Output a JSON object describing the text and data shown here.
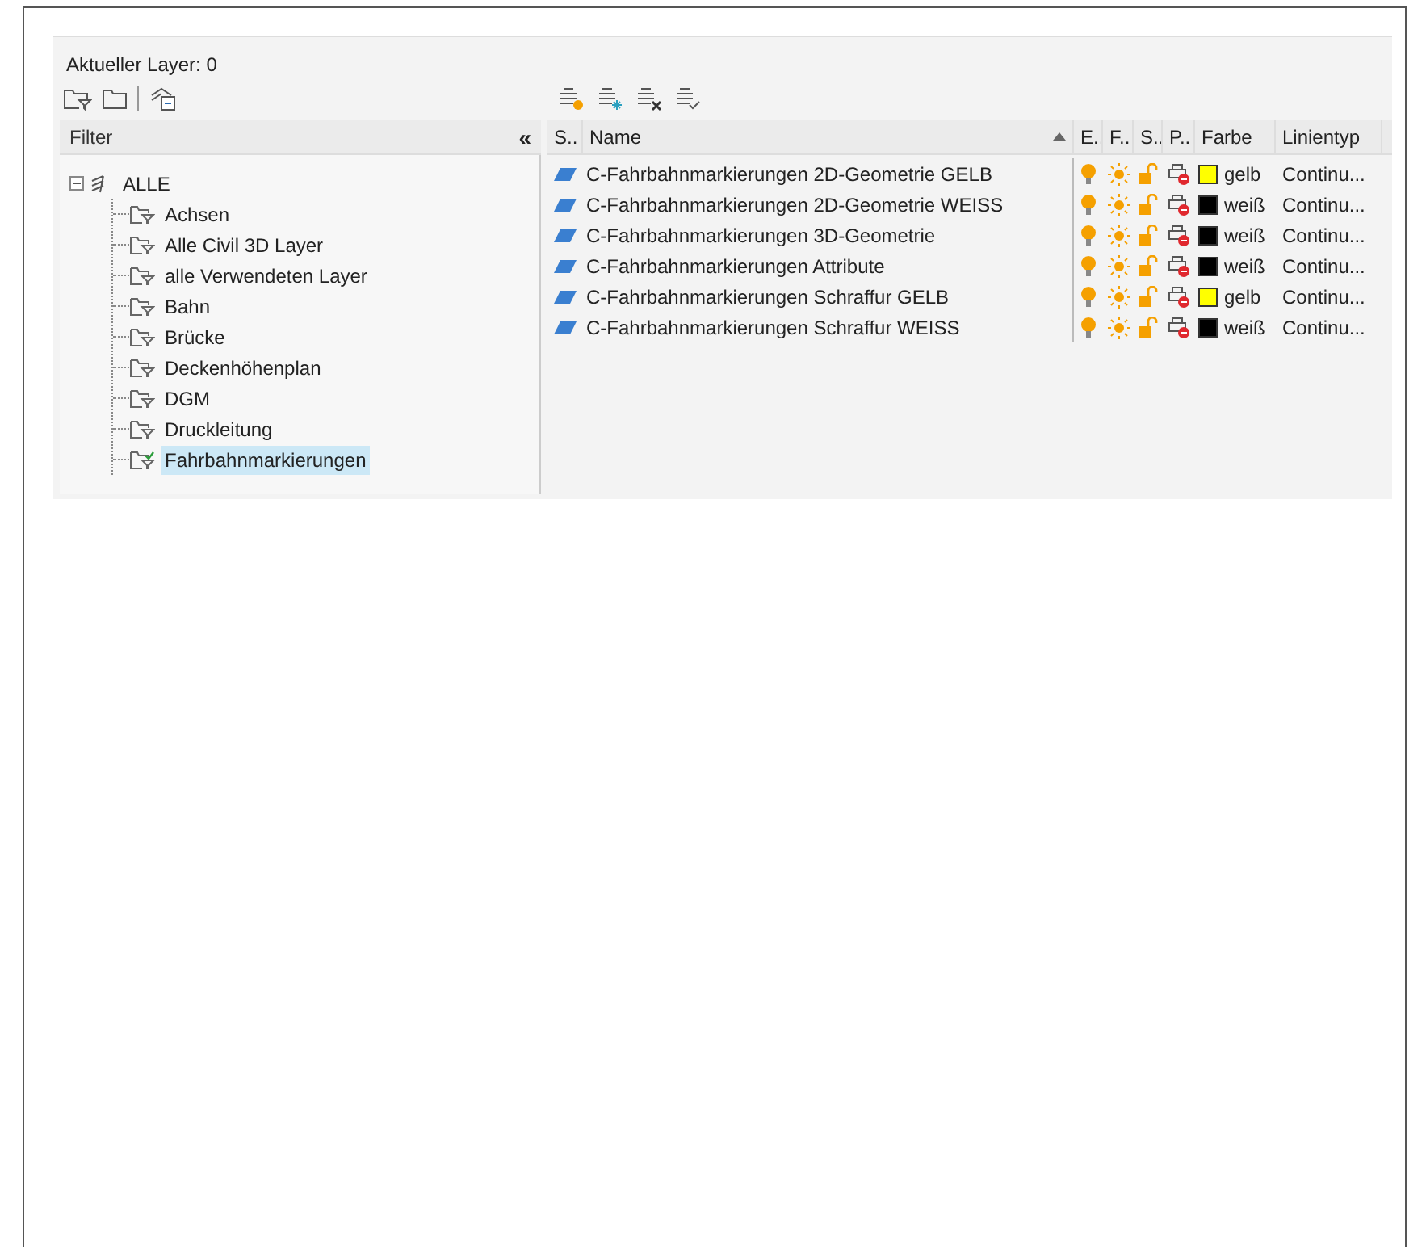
{
  "current_layer": "Aktueller Layer: 0",
  "filter_panel": {
    "title": "Filter",
    "collapse": "«",
    "tree": {
      "label": "ALLE",
      "expanded": true,
      "children": [
        {
          "label": "Achsen",
          "selected": false
        },
        {
          "label": "Alle Civil 3D Layer",
          "selected": false
        },
        {
          "label": "alle Verwendeten Layer",
          "selected": false
        },
        {
          "label": "Bahn",
          "selected": false
        },
        {
          "label": "Brücke",
          "selected": false
        },
        {
          "label": "Deckenhöhenplan",
          "selected": false
        },
        {
          "label": "DGM",
          "selected": false
        },
        {
          "label": "Druckleitung",
          "selected": false
        },
        {
          "label": "Fahrbahnmarkierungen",
          "selected": true
        }
      ]
    }
  },
  "table": {
    "columns": [
      "S..",
      "Name",
      "E..",
      "F..",
      "S..",
      "P..",
      "Farbe",
      "Linientyp"
    ],
    "rows": [
      {
        "name": "C-Fahrbahnmarkierungen 2D-Geometrie GELB",
        "color": "#ffff00",
        "color_name": "gelb",
        "linetype": "Continu..."
      },
      {
        "name": "C-Fahrbahnmarkierungen 2D-Geometrie WEISS",
        "color": "#000000",
        "color_name": "weiß",
        "linetype": "Continu..."
      },
      {
        "name": "C-Fahrbahnmarkierungen 3D-Geometrie",
        "color": "#000000",
        "color_name": "weiß",
        "linetype": "Continu..."
      },
      {
        "name": "C-Fahrbahnmarkierungen Attribute",
        "color": "#000000",
        "color_name": "weiß",
        "linetype": "Continu..."
      },
      {
        "name": "C-Fahrbahnmarkierungen Schraffur GELB",
        "color": "#ffff00",
        "color_name": "gelb",
        "linetype": "Continu..."
      },
      {
        "name": "C-Fahrbahnmarkierungen Schraffur WEISS",
        "color": "#000000",
        "color_name": "weiß",
        "linetype": "Continu..."
      }
    ]
  }
}
